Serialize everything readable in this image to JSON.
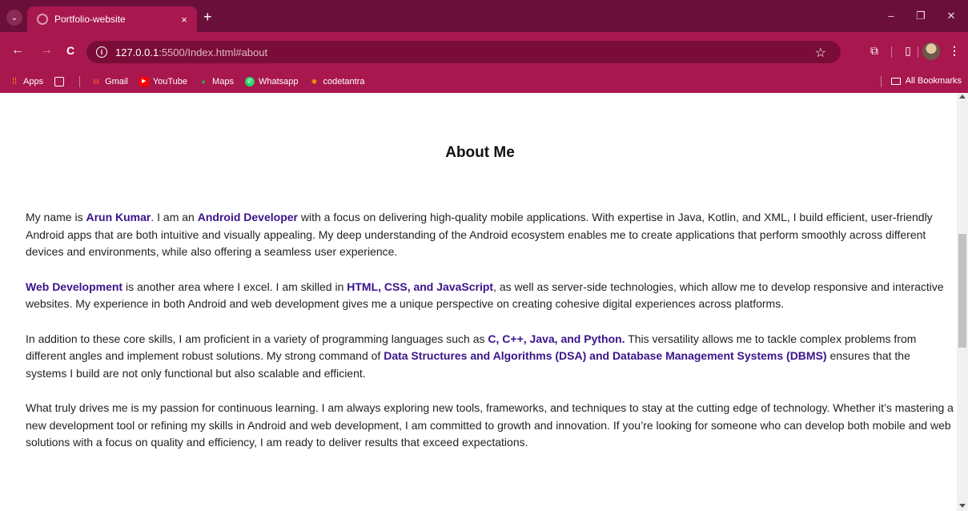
{
  "browser": {
    "tab": {
      "title": "Portfolio-website",
      "close": "×"
    },
    "new_tab": "+",
    "window_controls": {
      "minimize": "–",
      "restore": "❐",
      "close": "✕"
    },
    "nav": {
      "back": "←",
      "forward": "→",
      "reload": "C"
    },
    "address": {
      "host": "127.0.0.1",
      "rest": ":5500/Index.html#about"
    },
    "bookmarks": [
      {
        "label": "Apps",
        "icon": "apps-grid-icon",
        "color": "#f4b400"
      },
      {
        "label": "",
        "icon": "tab-groups-icon",
        "color": "#ffffff"
      },
      {
        "label": "Gmail",
        "icon": "gmail-icon",
        "color": "#ea4335"
      },
      {
        "label": "YouTube",
        "icon": "youtube-icon",
        "color": "#ff0000"
      },
      {
        "label": "Maps",
        "icon": "maps-icon",
        "color": "#34a853"
      },
      {
        "label": "Whatsapp",
        "icon": "whatsapp-icon",
        "color": "#25d366"
      },
      {
        "label": "codetantra",
        "icon": "codetantra-icon",
        "color": "#f0a500"
      }
    ],
    "all_bookmarks": "All Bookmarks",
    "theme_color": "#a8174e",
    "titlebar_color": "#6a0f3a"
  },
  "about": {
    "title": "About Me",
    "p1": {
      "t1": "My name is ",
      "h1": "Arun Kumar",
      "t2": ". I am an ",
      "h2": "Android Developer",
      "t3": " with a focus on delivering high-quality mobile applications. With expertise in Java, Kotlin, and XML, I build efficient, user-friendly Android apps that are both intuitive and visually appealing. My deep understanding of the Android ecosystem enables me to create applications that perform smoothly across different devices and environments, while also offering a seamless user experience."
    },
    "p2": {
      "h1": "Web Development",
      "t1": " is another area where I excel. I am skilled in ",
      "h2": "HTML, CSS, and JavaScript",
      "t2": ", as well as server-side technologies, which allow me to develop responsive and interactive websites. My experience in both Android and web development gives me a unique perspective on creating cohesive digital experiences across platforms."
    },
    "p3": {
      "t1": "In addition to these core skills, I am proficient in a variety of programming languages such as ",
      "h1": "C, C++, Java, and Python.",
      "t2": " This versatility allows me to tackle complex problems from different angles and implement robust solutions. My strong command of ",
      "h2": "Data Structures and Algorithms (DSA) and Database Management Systems (DBMS)",
      "t3": " ensures that the systems I build are not only functional but also scalable and efficient."
    },
    "p4": {
      "t1": "What truly drives me is my passion for continuous learning. I am always exploring new tools, frameworks, and techniques to stay at the cutting edge of technology. Whether it’s mastering a new development tool or refining my skills in Android and web development, I am committed to growth and innovation. If you’re looking for someone who can develop both mobile and web solutions with a focus on quality and efficiency, I am ready to deliver results that exceed expectations."
    },
    "highlight_color": "#3a148a"
  }
}
